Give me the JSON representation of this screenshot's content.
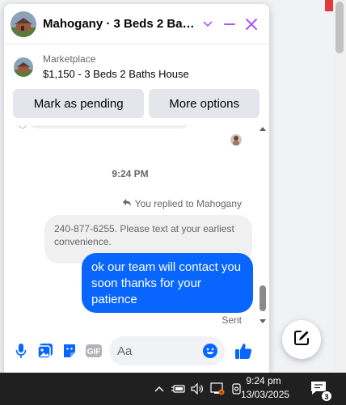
{
  "chat": {
    "title": "Mahogany · 3 Beds 2 Bath…",
    "listing": {
      "source": "Marketplace",
      "title": "$1,150 - 3 Beds 2 Baths House",
      "mark_pending_label": "Mark as pending",
      "more_options_label": "More options"
    },
    "messages": {
      "timestamp": "9:24 PM",
      "reply_context": "You replied to Mahogany",
      "quoted_text": "240-877-6255. Please text at your earliest convenience.",
      "outgoing_text": "ok our team will contact you soon thanks for your patience",
      "status": "Sent"
    },
    "composer": {
      "placeholder": "Aa",
      "gif_label": "GIF"
    }
  },
  "taskbar": {
    "time": "9:24 pm",
    "date": "13/03/2025",
    "notification_count": "3"
  },
  "colors": {
    "accent": "#0866ff",
    "header_icons": "#a855f7",
    "bubble_incoming": "#f0f0f0",
    "taskbar": "#202020"
  },
  "icons": [
    "chevron-down-icon",
    "minimize-icon",
    "close-icon",
    "reply-arrow-icon",
    "microphone-icon",
    "photo-icon",
    "sticker-icon",
    "gif-icon",
    "emoji-icon",
    "thumbs-up-icon",
    "compose-icon",
    "chevron-up-icon",
    "battery-icon",
    "volume-icon",
    "network-icon",
    "meet-icon",
    "notification-icon"
  ]
}
